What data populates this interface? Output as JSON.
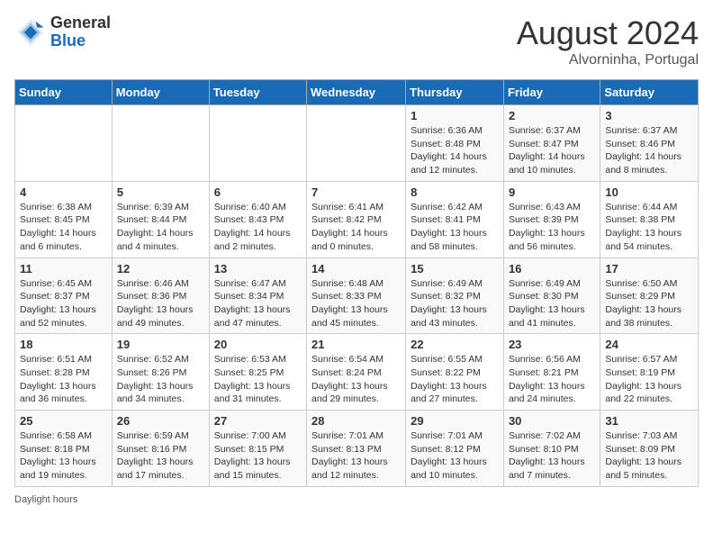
{
  "header": {
    "logo_general": "General",
    "logo_blue": "Blue",
    "month_year": "August 2024",
    "location": "Alvorninha, Portugal"
  },
  "days_of_week": [
    "Sunday",
    "Monday",
    "Tuesday",
    "Wednesday",
    "Thursday",
    "Friday",
    "Saturday"
  ],
  "weeks": [
    [
      {
        "day": "",
        "info": ""
      },
      {
        "day": "",
        "info": ""
      },
      {
        "day": "",
        "info": ""
      },
      {
        "day": "",
        "info": ""
      },
      {
        "day": "1",
        "info": "Sunrise: 6:36 AM\nSunset: 8:48 PM\nDaylight: 14 hours and 12 minutes."
      },
      {
        "day": "2",
        "info": "Sunrise: 6:37 AM\nSunset: 8:47 PM\nDaylight: 14 hours and 10 minutes."
      },
      {
        "day": "3",
        "info": "Sunrise: 6:37 AM\nSunset: 8:46 PM\nDaylight: 14 hours and 8 minutes."
      }
    ],
    [
      {
        "day": "4",
        "info": "Sunrise: 6:38 AM\nSunset: 8:45 PM\nDaylight: 14 hours and 6 minutes."
      },
      {
        "day": "5",
        "info": "Sunrise: 6:39 AM\nSunset: 8:44 PM\nDaylight: 14 hours and 4 minutes."
      },
      {
        "day": "6",
        "info": "Sunrise: 6:40 AM\nSunset: 8:43 PM\nDaylight: 14 hours and 2 minutes."
      },
      {
        "day": "7",
        "info": "Sunrise: 6:41 AM\nSunset: 8:42 PM\nDaylight: 14 hours and 0 minutes."
      },
      {
        "day": "8",
        "info": "Sunrise: 6:42 AM\nSunset: 8:41 PM\nDaylight: 13 hours and 58 minutes."
      },
      {
        "day": "9",
        "info": "Sunrise: 6:43 AM\nSunset: 8:39 PM\nDaylight: 13 hours and 56 minutes."
      },
      {
        "day": "10",
        "info": "Sunrise: 6:44 AM\nSunset: 8:38 PM\nDaylight: 13 hours and 54 minutes."
      }
    ],
    [
      {
        "day": "11",
        "info": "Sunrise: 6:45 AM\nSunset: 8:37 PM\nDaylight: 13 hours and 52 minutes."
      },
      {
        "day": "12",
        "info": "Sunrise: 6:46 AM\nSunset: 8:36 PM\nDaylight: 13 hours and 49 minutes."
      },
      {
        "day": "13",
        "info": "Sunrise: 6:47 AM\nSunset: 8:34 PM\nDaylight: 13 hours and 47 minutes."
      },
      {
        "day": "14",
        "info": "Sunrise: 6:48 AM\nSunset: 8:33 PM\nDaylight: 13 hours and 45 minutes."
      },
      {
        "day": "15",
        "info": "Sunrise: 6:49 AM\nSunset: 8:32 PM\nDaylight: 13 hours and 43 minutes."
      },
      {
        "day": "16",
        "info": "Sunrise: 6:49 AM\nSunset: 8:30 PM\nDaylight: 13 hours and 41 minutes."
      },
      {
        "day": "17",
        "info": "Sunrise: 6:50 AM\nSunset: 8:29 PM\nDaylight: 13 hours and 38 minutes."
      }
    ],
    [
      {
        "day": "18",
        "info": "Sunrise: 6:51 AM\nSunset: 8:28 PM\nDaylight: 13 hours and 36 minutes."
      },
      {
        "day": "19",
        "info": "Sunrise: 6:52 AM\nSunset: 8:26 PM\nDaylight: 13 hours and 34 minutes."
      },
      {
        "day": "20",
        "info": "Sunrise: 6:53 AM\nSunset: 8:25 PM\nDaylight: 13 hours and 31 minutes."
      },
      {
        "day": "21",
        "info": "Sunrise: 6:54 AM\nSunset: 8:24 PM\nDaylight: 13 hours and 29 minutes."
      },
      {
        "day": "22",
        "info": "Sunrise: 6:55 AM\nSunset: 8:22 PM\nDaylight: 13 hours and 27 minutes."
      },
      {
        "day": "23",
        "info": "Sunrise: 6:56 AM\nSunset: 8:21 PM\nDaylight: 13 hours and 24 minutes."
      },
      {
        "day": "24",
        "info": "Sunrise: 6:57 AM\nSunset: 8:19 PM\nDaylight: 13 hours and 22 minutes."
      }
    ],
    [
      {
        "day": "25",
        "info": "Sunrise: 6:58 AM\nSunset: 8:18 PM\nDaylight: 13 hours and 19 minutes."
      },
      {
        "day": "26",
        "info": "Sunrise: 6:59 AM\nSunset: 8:16 PM\nDaylight: 13 hours and 17 minutes."
      },
      {
        "day": "27",
        "info": "Sunrise: 7:00 AM\nSunset: 8:15 PM\nDaylight: 13 hours and 15 minutes."
      },
      {
        "day": "28",
        "info": "Sunrise: 7:01 AM\nSunset: 8:13 PM\nDaylight: 13 hours and 12 minutes."
      },
      {
        "day": "29",
        "info": "Sunrise: 7:01 AM\nSunset: 8:12 PM\nDaylight: 13 hours and 10 minutes."
      },
      {
        "day": "30",
        "info": "Sunrise: 7:02 AM\nSunset: 8:10 PM\nDaylight: 13 hours and 7 minutes."
      },
      {
        "day": "31",
        "info": "Sunrise: 7:03 AM\nSunset: 8:09 PM\nDaylight: 13 hours and 5 minutes."
      }
    ]
  ],
  "footer": {
    "note": "Daylight hours"
  }
}
